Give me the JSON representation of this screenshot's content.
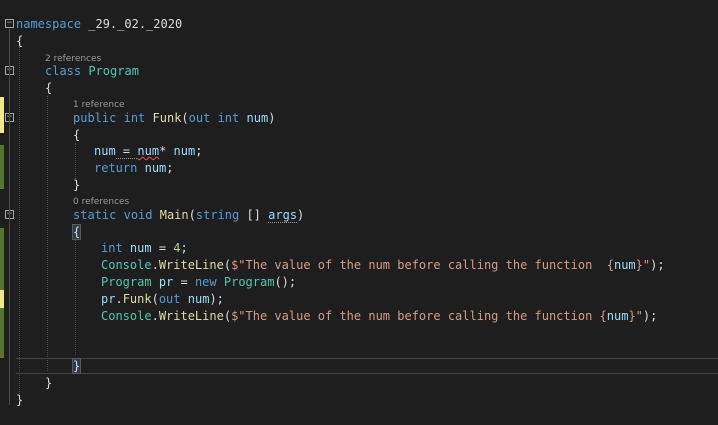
{
  "editor": {
    "codelens": {
      "program_refs": "2 references",
      "funk_refs": "1 reference",
      "main_refs": "0 references"
    },
    "lines": {
      "l1": {
        "kw": "namespace",
        "rest": " _29._02._2020"
      },
      "l2": "{",
      "l3": {
        "kw": "class",
        "name": "Program"
      },
      "l4": "{",
      "l5": {
        "kw1": "public",
        "kw2": "int",
        "name": "Funk",
        "p1": "(",
        "kw3": "out",
        "kw4": "int",
        "arg": "num",
        "p2": ")"
      },
      "l6": "{",
      "l7": {
        "a": "num",
        "op": " = ",
        "b": "num",
        "op2": "* ",
        "c": "num",
        "end": ";"
      },
      "l8": {
        "kw": "return",
        "var": "num",
        "end": ";"
      },
      "l9": "}",
      "l10": {
        "kw1": "static",
        "kw2": "void",
        "name": "Main",
        "p1": "(",
        "kw3": "string",
        "p2": " [] ",
        "arg": "args",
        "p3": ")"
      },
      "l11": "{",
      "l12": {
        "kw": "int",
        "var": "num",
        "op": " = ",
        "num": "4",
        "end": ";"
      },
      "l13": {
        "cls": "Console",
        "dot": ".",
        "meth": "WriteLine",
        "p1": "(",
        "str": "$\"The value of the num before calling the function  {",
        "var": "num",
        "str2": "}\"",
        "p2": ");"
      },
      "l14": {
        "cls": "Program",
        "var": "pr",
        "op": " = ",
        "kw": "new",
        "cls2": "Program",
        "end": "();"
      },
      "l15": {
        "var": "pr",
        "dot": ".",
        "meth": "Funk",
        "p1": "(",
        "kw": "out",
        "var2": "num",
        "end": ");"
      },
      "l16": {
        "cls": "Console",
        "dot": ".",
        "meth": "WriteLine",
        "p1": "(",
        "str": "$\"The value of the num before calling the function {",
        "var": "num",
        "str2": "}\"",
        "p2": ");"
      },
      "l19": "}",
      "l20": "}",
      "l21": "}"
    },
    "colors": {
      "background": "#1e1e1e",
      "keyword": "#569cd6",
      "type": "#4ec9b0",
      "method": "#dcdcaa",
      "variable": "#9cdcfe",
      "string": "#d69d85",
      "number": "#b5cea8",
      "change_saved": "#577430",
      "change_unsaved": "#efe68e"
    }
  }
}
